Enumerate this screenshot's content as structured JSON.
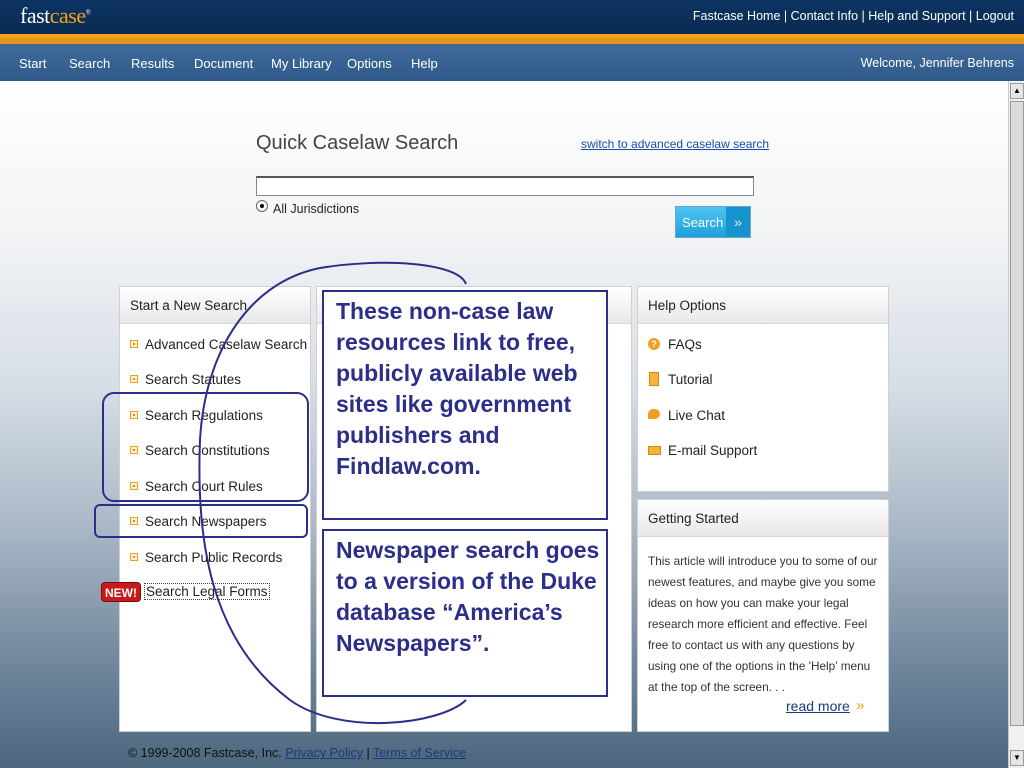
{
  "header": {
    "logo_main": "fast",
    "logo_accent": "case",
    "logo_mark": "®",
    "top_links": [
      "Fastcase Home",
      "Contact Info",
      "Help and Support",
      "Logout"
    ],
    "separator": "|"
  },
  "nav": {
    "items": [
      "Start",
      "Search",
      "Results",
      "Document",
      "My Library",
      "Options",
      "Help"
    ],
    "welcome": "Welcome, Jennifer Behrens"
  },
  "quick_search": {
    "title": "Quick Caselaw Search",
    "advanced_link": "switch to advanced caselaw search",
    "input_value": "",
    "jurisdiction_option": "All Jurisdictions",
    "search_button": "Search",
    "search_chevron": "»"
  },
  "start_panel": {
    "title": "Start a New Search",
    "items": [
      "Advanced Caselaw Search",
      "Search Statutes",
      "Search Regulations",
      "Search Constitutions",
      "Search Court Rules",
      "Search Newspapers",
      "Search Public Records"
    ],
    "new_badge": "NEW!",
    "new_item": "Search Legal Forms"
  },
  "help_panel": {
    "title": "Help Options",
    "items": [
      "FAQs",
      "Tutorial",
      "Live Chat",
      "E-mail Support"
    ]
  },
  "getting_started": {
    "title": "Getting Started",
    "body": "This article will introduce you to some of our newest features, and maybe give you some ideas on how you can make your legal research more efficient and effective. Feel free to contact us with any questions by using one of the options in the 'Help' menu at the top of the screen. . .",
    "read_more": "read more",
    "chevron": "»"
  },
  "callouts": {
    "first": "These non-case law resources link to free, publicly available web sites like government publishers and Findlaw.com.",
    "second": "Newspaper search goes to a version of the Duke database “America’s Newspapers”."
  },
  "footer": {
    "copyright": "©  1999-2008  Fastcase, Inc.",
    "privacy": "Privacy Policy",
    "separator": "|",
    "terms": "Terms of Service"
  },
  "colors": {
    "header_bg": "#0d3463",
    "accent_orange": "#f6a21a",
    "nav_bg": "#3a6595",
    "annotation_blue": "#2b2f8a",
    "search_button": "#2aaee6"
  },
  "icons": {
    "faq": "question-circle-icon",
    "tutorial": "document-icon",
    "chat": "speech-bubble-icon",
    "email": "envelope-icon",
    "bullet": "square-bullet-icon"
  }
}
